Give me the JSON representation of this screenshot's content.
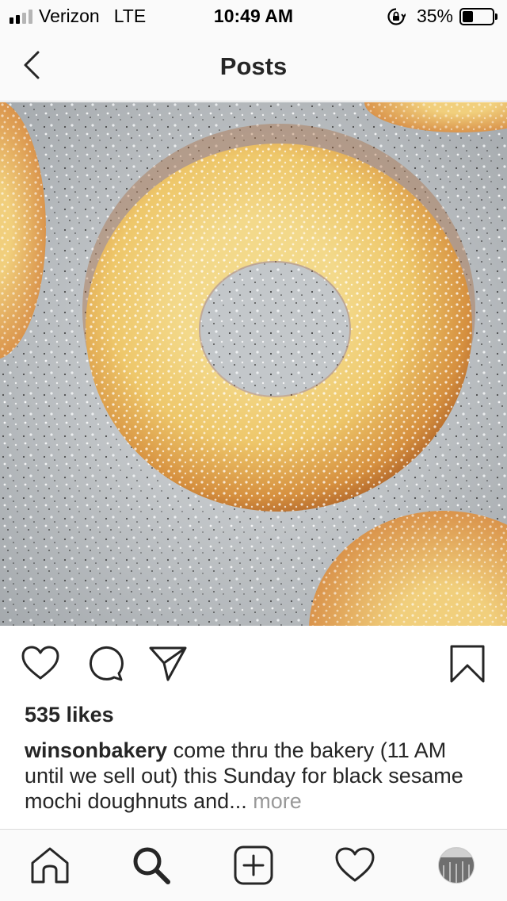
{
  "status_bar": {
    "carrier": "Verizon",
    "network": "LTE",
    "time": "10:49 AM",
    "battery_percent": "35%",
    "battery_level": 0.35,
    "signal_bars_total": 4,
    "signal_bars_active": 2
  },
  "header": {
    "title": "Posts",
    "back_icon": "chevron-left-icon"
  },
  "post": {
    "image_subject": "sugar-coated doughnut",
    "likes": "535 likes",
    "username": "winsonbakery",
    "caption_text": " come thru the bakery (11 AM until we sell out) this Sunday for black sesame mochi doughnuts and... ",
    "more_label": "more",
    "actions": [
      "heart-icon",
      "comment-icon",
      "share-icon",
      "bookmark-icon"
    ]
  },
  "tabbar": {
    "items": [
      "home-icon",
      "search-icon",
      "add-post-icon",
      "activity-heart-icon",
      "profile-avatar"
    ]
  },
  "colors": {
    "text": "#262626",
    "muted": "#999999",
    "bar_bg": "#fafafa",
    "divider": "#dbdbdb"
  }
}
